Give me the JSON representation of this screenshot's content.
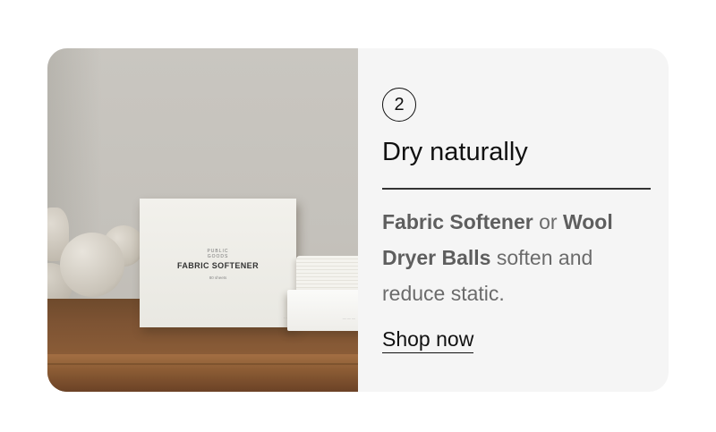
{
  "card": {
    "step_number": "2",
    "title": "Dry naturally",
    "description": {
      "product_1": "Fabric Softener",
      "connector": " or ",
      "product_2": "Wool Dryer Balls",
      "rest": " soften and reduce static."
    },
    "cta_label": "Shop now"
  },
  "image": {
    "box_brand_line_1": "PUBLIC",
    "box_brand_line_2": "GOODS",
    "box_title": "FABRIC SOFTENER",
    "box_subtitle": "80 sheets"
  },
  "colors": {
    "card_background": "#f5f5f5",
    "text_primary": "#111111",
    "text_muted": "#6b6b6b"
  }
}
